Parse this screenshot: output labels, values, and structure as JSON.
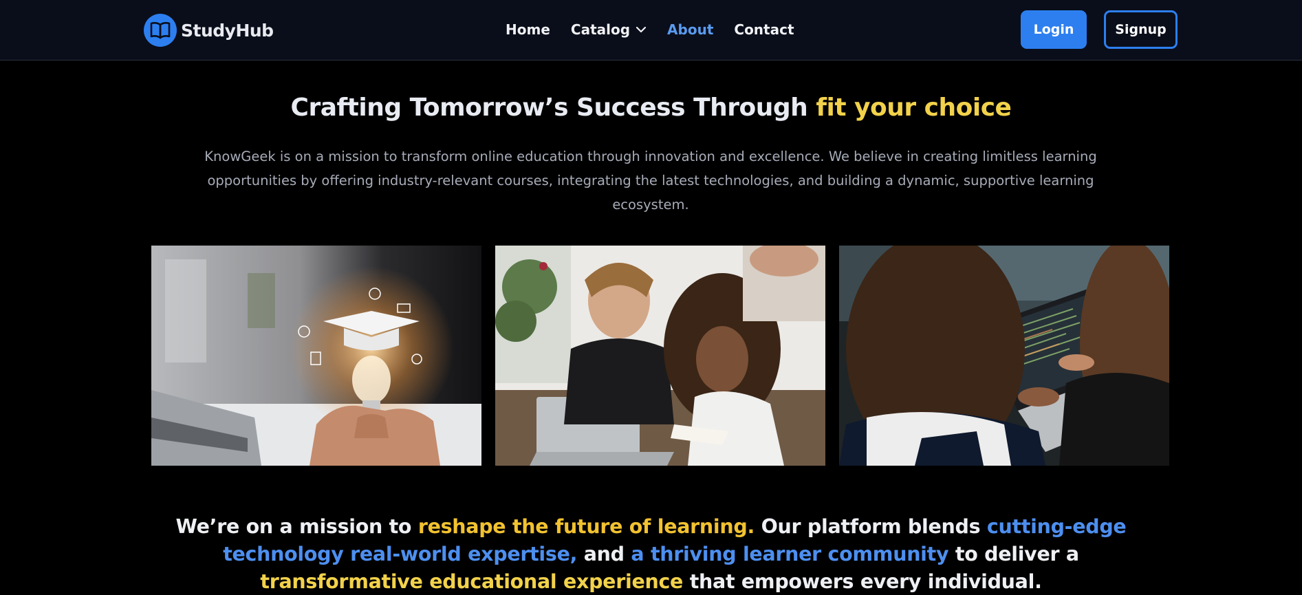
{
  "brand": {
    "name": "StudyHub",
    "icon": "book-open-icon"
  },
  "nav": {
    "home": "Home",
    "catalog": "Catalog",
    "about": "About",
    "contact": "Contact"
  },
  "auth": {
    "login": "Login",
    "signup": "Signup"
  },
  "hero": {
    "title_main": "Crafting Tomorrow’s Success Through ",
    "title_highlight": "fit your choice",
    "description": "KnowGeek is on a mission to transform online education through innovation and excellence. We believe in creating limitless learning opportunities by offering industry-relevant courses, integrating the latest technologies, and building a dynamic, supportive learning ecosystem."
  },
  "mission": {
    "p1": "We’re on a mission to ",
    "h1": "reshape the future of learning.",
    "p2": " Our platform blends ",
    "h2": "cutting-edge technology real-world expertise,",
    "p3": " and ",
    "h3": "a thriving learner community",
    "p4": " to deliver a ",
    "h4": "transformative educational experience",
    "p5": " that empowers every individual."
  },
  "colors": {
    "accent": "#2d7ff0",
    "highlight_yellow": "#f2d24b",
    "highlight_blue": "#4d8ff0",
    "nav_bg": "#0a0e1a",
    "page_bg": "#000000"
  }
}
